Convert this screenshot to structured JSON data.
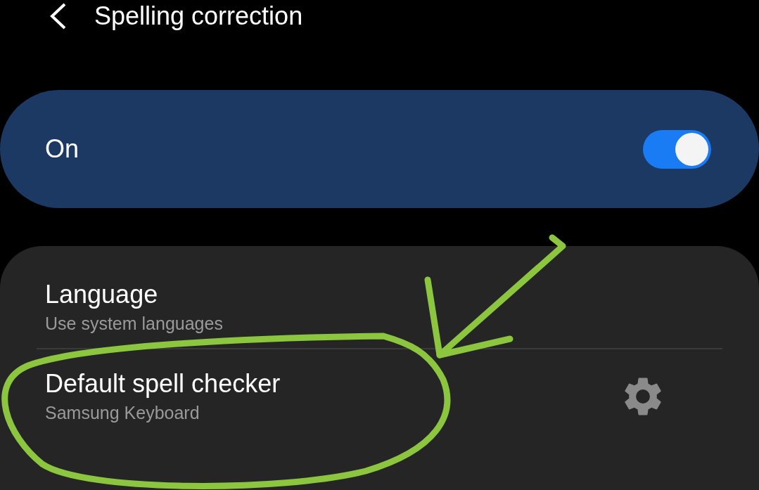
{
  "header": {
    "title": "Spelling correction"
  },
  "master_switch": {
    "label": "On",
    "on": true
  },
  "settings": [
    {
      "title": "Language",
      "subtitle": "Use system languages",
      "has_gear": false
    },
    {
      "title": "Default spell checker",
      "subtitle": "Samsung Keyboard",
      "has_gear": true
    }
  ]
}
